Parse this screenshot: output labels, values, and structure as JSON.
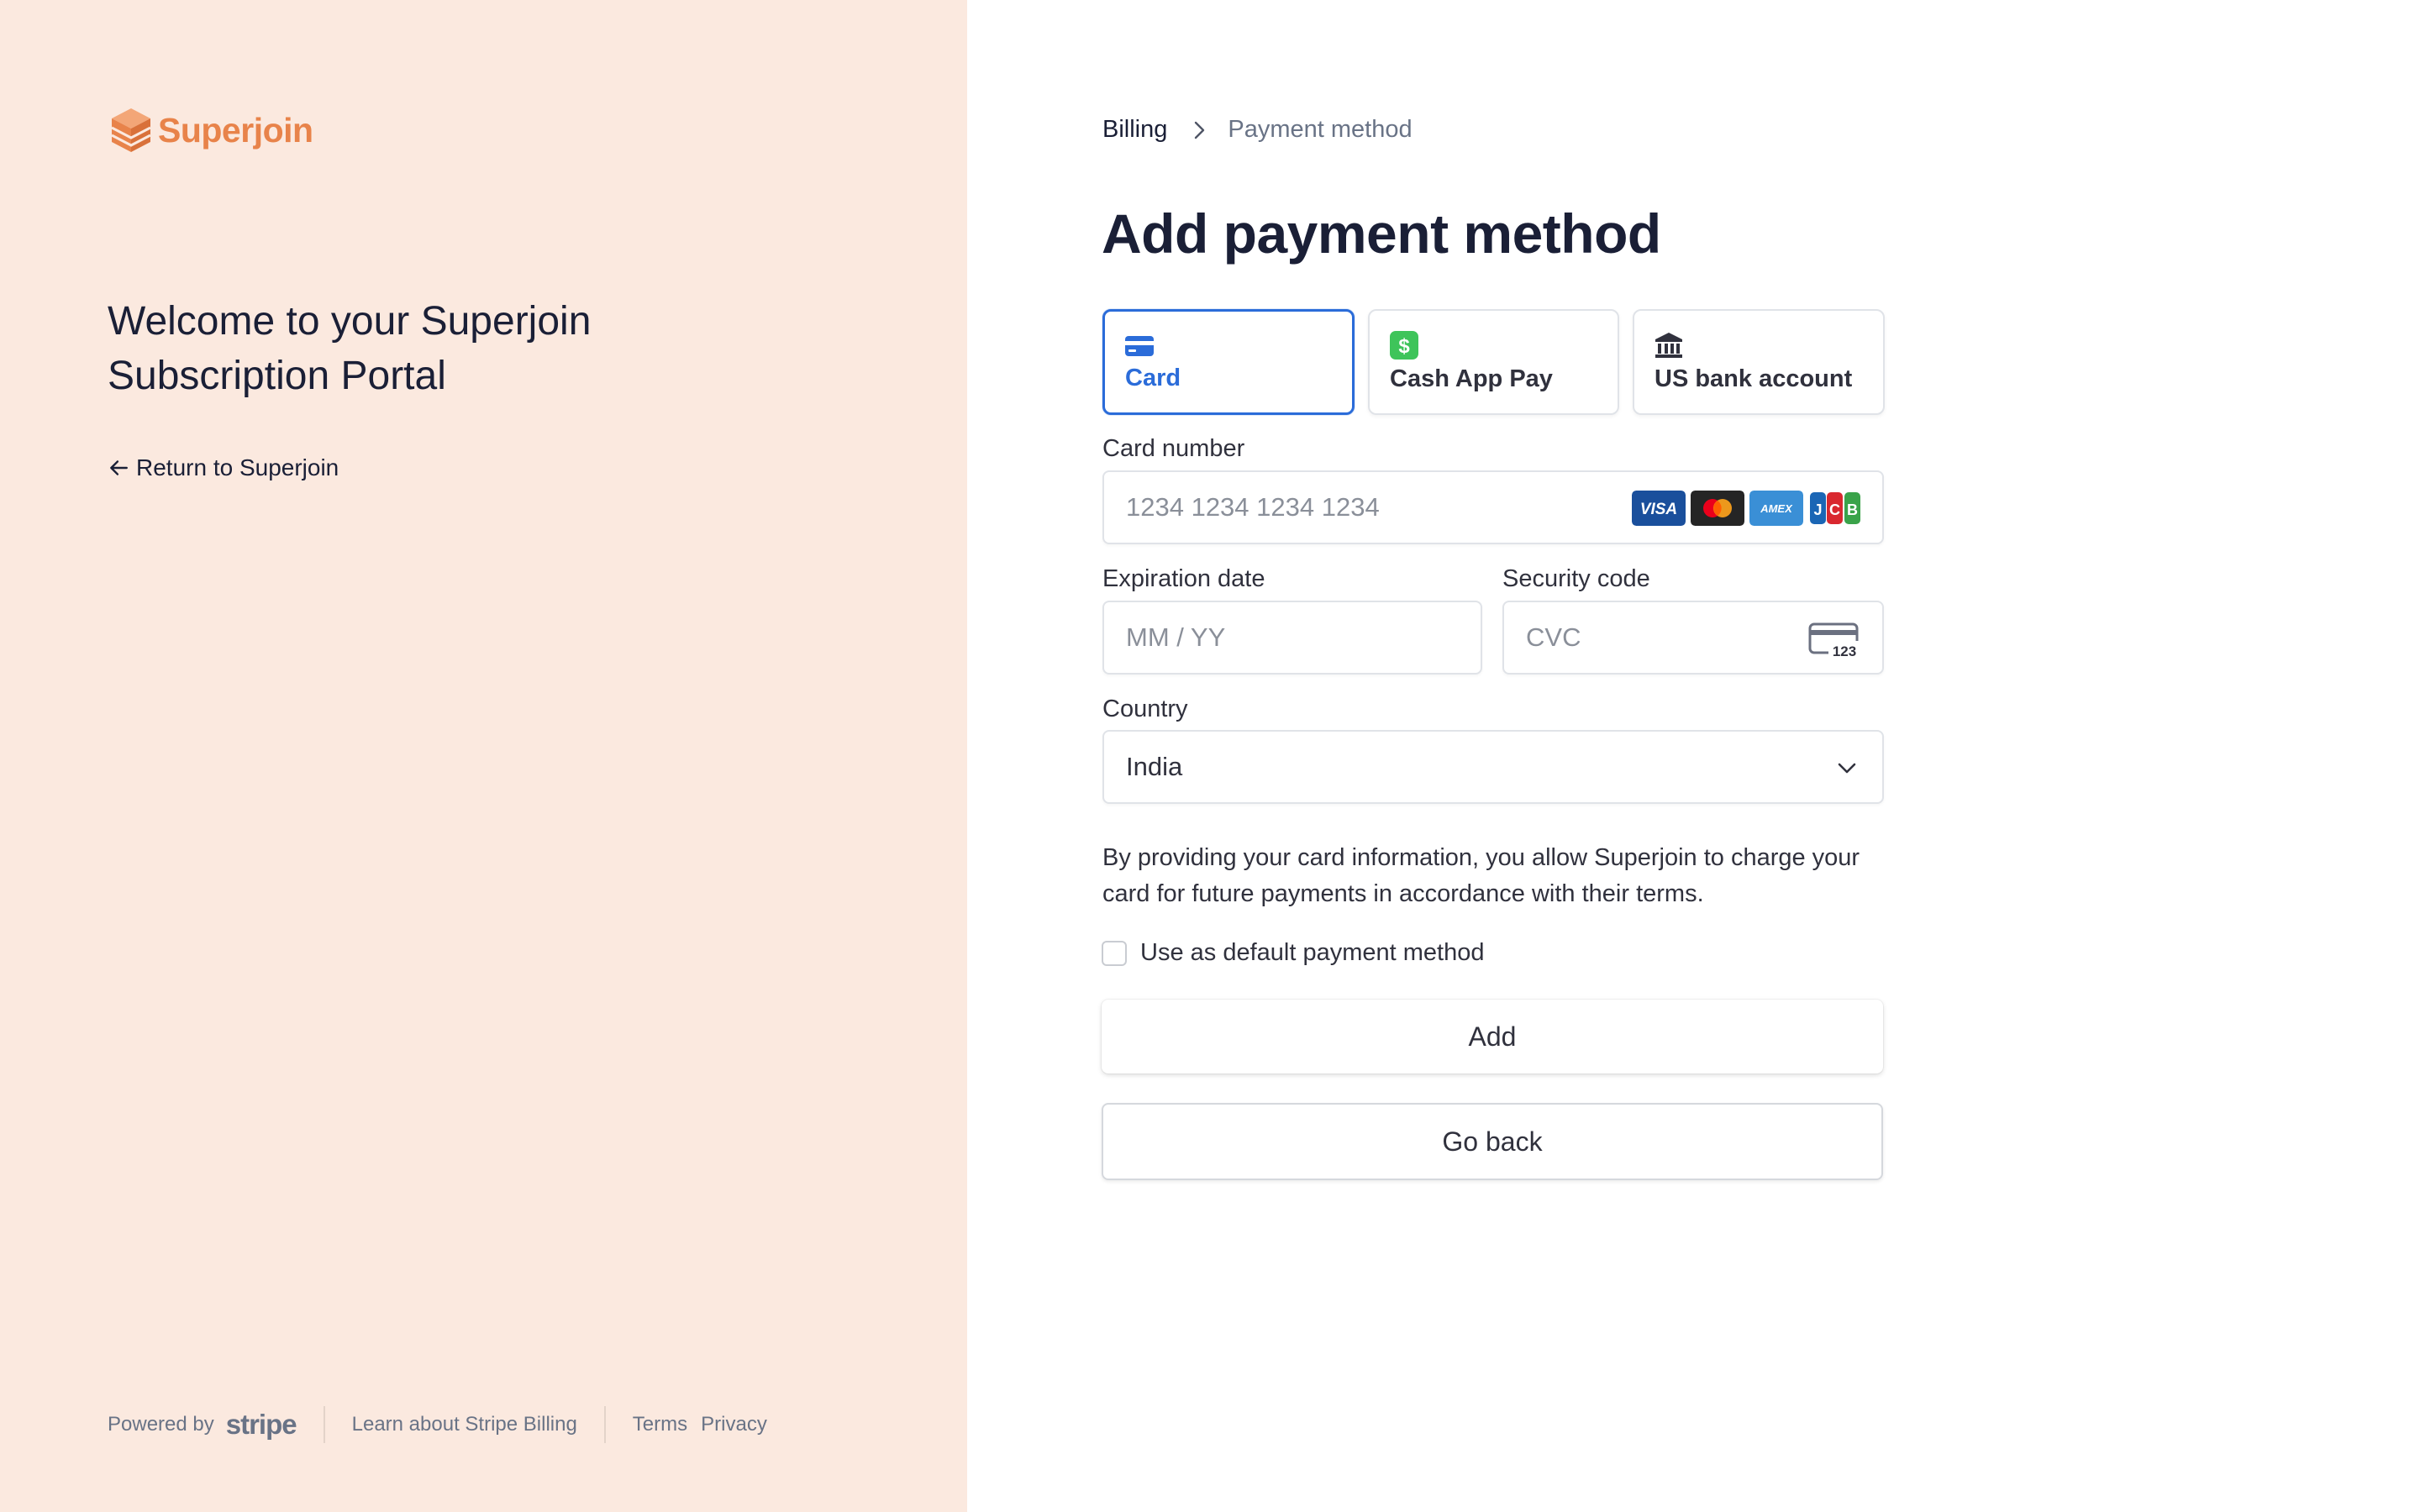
{
  "brand": {
    "name": "Superjoin",
    "color": "#e8834a"
  },
  "left": {
    "welcome": "Welcome to your Superjoin Subscription Portal",
    "return_link": "Return to Superjoin",
    "panel_color": "#fbe9df"
  },
  "footer": {
    "powered_by": "Powered by",
    "stripe": "stripe",
    "learn": "Learn about Stripe Billing",
    "terms": "Terms",
    "privacy": "Privacy"
  },
  "breadcrumb": {
    "parent": "Billing",
    "current": "Payment method"
  },
  "title": "Add payment method",
  "tabs": [
    {
      "label": "Card",
      "icon": "credit-card-icon",
      "active": true
    },
    {
      "label": "Cash App Pay",
      "icon": "cash-app-icon",
      "active": false
    },
    {
      "label": "US bank account",
      "icon": "bank-icon",
      "active": false
    }
  ],
  "form": {
    "card_number": {
      "label": "Card number",
      "placeholder": "1234 1234 1234 1234",
      "brands": [
        "VISA",
        "Mastercard",
        "AMEX",
        "JCB"
      ]
    },
    "expiration": {
      "label": "Expiration date",
      "placeholder": "MM / YY"
    },
    "security": {
      "label": "Security code",
      "placeholder": "CVC",
      "icon_text": "123"
    },
    "country": {
      "label": "Country",
      "value": "India"
    }
  },
  "consent": "By providing your card information, you allow Superjoin to charge your card for future payments in accordance with their terms.",
  "default_checkbox": {
    "label": "Use as default payment method",
    "checked": false
  },
  "buttons": {
    "add": "Add",
    "back": "Go back"
  },
  "accent": "#2b6cd9"
}
